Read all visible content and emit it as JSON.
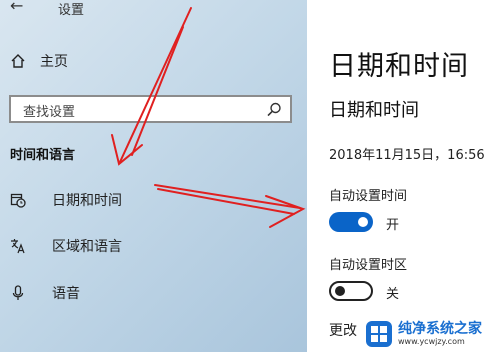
{
  "window": {
    "title": "设置"
  },
  "sidebar": {
    "back_icon": "back-arrow-icon",
    "home": {
      "label": "主页",
      "icon": "home-icon"
    },
    "search": {
      "placeholder": "查找设置",
      "icon": "search-icon"
    },
    "section_heading": "时间和语言",
    "items": [
      {
        "label": "日期和时间",
        "icon": "calendar-clock-icon"
      },
      {
        "label": "区域和语言",
        "icon": "language-icon"
      },
      {
        "label": "语音",
        "icon": "microphone-icon"
      }
    ]
  },
  "main": {
    "page_title": "日期和时间",
    "section_title": "日期和时间",
    "current_datetime": "2018年11月15日，16:56",
    "auto_time": {
      "label": "自动设置时间",
      "state_text": "开",
      "on": true
    },
    "auto_timezone": {
      "label": "自动设置时区",
      "state_text": "关",
      "on": false
    },
    "more_truncated": "更改"
  },
  "watermark": {
    "name": "纯净系统之家",
    "url": "www.ycwjzy.com"
  },
  "colors": {
    "accent": "#0a64c8",
    "arrow": "#e02020",
    "sidebar_bg": "#c3d8e8"
  }
}
